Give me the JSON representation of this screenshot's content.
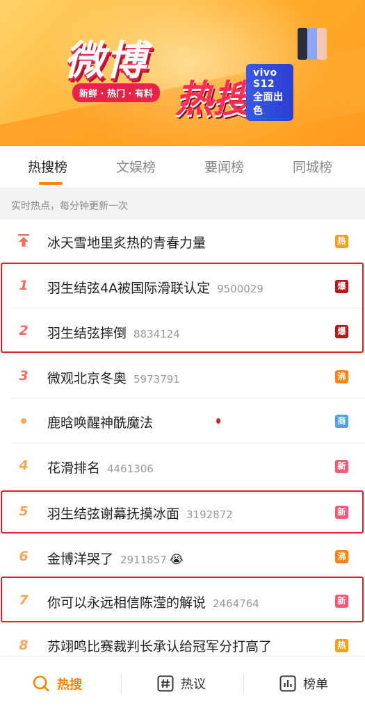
{
  "banner": {
    "logo_top": "微博",
    "logo_bottom": "热搜",
    "slogan": "新鲜 · 热门 · 有料",
    "ad": "vivo S12 全面出色"
  },
  "tabs": [
    {
      "label": "热搜榜",
      "active": true
    },
    {
      "label": "文娱榜",
      "active": false
    },
    {
      "label": "要闻榜",
      "active": false
    },
    {
      "label": "同城榜",
      "active": false
    }
  ],
  "subheader": "实时热点，每分钟更新一次",
  "list": [
    {
      "rank": "",
      "rank_icon": "pinned-arrow-icon",
      "title": "冰天雪地里炙热的青春力量",
      "count": "",
      "badge": "热",
      "badge_color": "#f0a21c",
      "highlighted": false
    },
    {
      "rank": "1",
      "title": "羽生结弦4A被国际滑联认定",
      "count": "9500029",
      "badge": "爆",
      "badge_color": "#b7161b",
      "highlighted": true
    },
    {
      "rank": "2",
      "title": "羽生结弦摔倒",
      "count": "8834124",
      "badge": "爆",
      "badge_color": "#b7161b",
      "highlighted": true
    },
    {
      "rank": "3",
      "title": "微观北京冬奥",
      "count": "5973791",
      "badge": "沸",
      "badge_color": "#f7821e",
      "highlighted": false
    },
    {
      "rank": "",
      "rank_icon": "ad-dot-icon",
      "title": "鹿晗唤醒神酰魔法",
      "count": "",
      "badge": "商",
      "badge_color": "#5c9ee6",
      "highlighted": false
    },
    {
      "rank": "4",
      "title": "花滑排名",
      "count": "4461306",
      "badge": "新",
      "badge_color": "#f55a78",
      "highlighted": false
    },
    {
      "rank": "5",
      "title": "羽生结弦谢幕抚摸冰面",
      "count": "3192872",
      "badge": "新",
      "badge_color": "#f55a78",
      "highlighted": true
    },
    {
      "rank": "6",
      "title": "金博洋哭了",
      "count": "2911857",
      "emoji": "😭",
      "badge": "沸",
      "badge_color": "#f7821e",
      "highlighted": false
    },
    {
      "rank": "7",
      "title": "你可以永远相信陈滢的解说",
      "count": "2464764",
      "badge": "新",
      "badge_color": "#f55a78",
      "highlighted": true
    },
    {
      "rank": "8",
      "title": "苏翊鸣比赛裁判长承认给冠军分打高了",
      "count": "",
      "badge": "热",
      "badge_color": "#f0a21c",
      "highlighted": false
    }
  ],
  "bottom_nav": [
    {
      "label": "热搜",
      "icon": "hot-search-icon",
      "active": true
    },
    {
      "label": "热议",
      "icon": "hashtag-icon",
      "active": false
    },
    {
      "label": "榜单",
      "icon": "chart-list-icon",
      "active": false
    }
  ],
  "colors": {
    "accent": "#ff8200",
    "highlight_border": "#e02020",
    "top_rank": "#f26d5f",
    "other_rank": "#f5a65b"
  }
}
